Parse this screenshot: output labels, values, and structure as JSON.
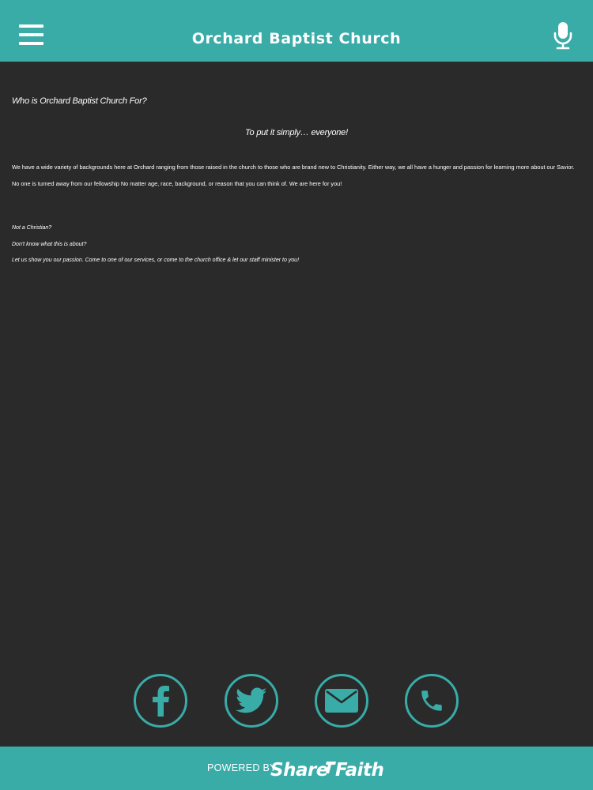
{
  "header": {
    "title": "Orchard Baptist Church",
    "menu_icon": "hamburger-menu-icon",
    "mic_icon": "microphone-icon"
  },
  "content": {
    "heading": "Who is Orchard Baptist Church For?",
    "tagline": "To put it simply… everyone!",
    "paragraph": "We have a wide variety of backgrounds here at Orchard ranging from those raised in the church to those who are brand new to Christianity. Either way, we all have a hunger and passion for learning more about our Savior. No one is turned away from our fellowship No matter age, race, background, or reason that you can think of. We are here for you!",
    "notes": [
      "Not a Christian?",
      "Don't know what this is about?",
      "Let us show you our passion. Come to one of our services, or come to the church office & let our staff minister to you!"
    ]
  },
  "social": {
    "icons": [
      "facebook-icon",
      "twitter-icon",
      "mail-icon",
      "phone-icon"
    ]
  },
  "footer": {
    "powered_by": "POWERED BY",
    "logo_text": "ShareFaith"
  },
  "colors": {
    "accent": "#39aca8",
    "background": "#2a2a2b",
    "text": "#ffffff"
  }
}
